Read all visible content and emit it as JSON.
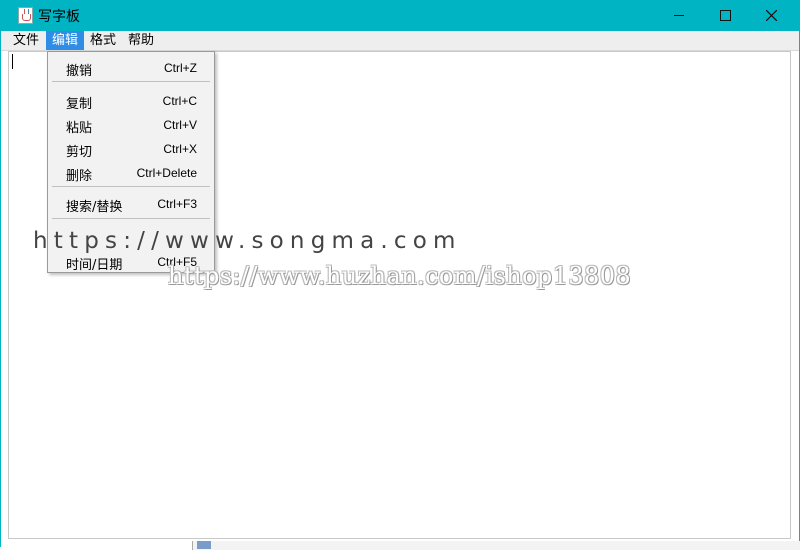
{
  "window": {
    "title": "写字板",
    "controls": [
      "minimize-icon",
      "maximize-icon",
      "close-icon"
    ],
    "title_bar_color": "#00b4c4"
  },
  "menubar": {
    "items": [
      {
        "label": "文件",
        "active": false
      },
      {
        "label": "编辑",
        "active": true
      },
      {
        "label": "格式",
        "active": false
      },
      {
        "label": "帮助",
        "active": false
      }
    ],
    "active_color": "#2f8de6"
  },
  "edit_menu": {
    "items": [
      {
        "label": "撤销",
        "shortcut": "Ctrl+Z"
      },
      {
        "label": "复制",
        "shortcut": "Ctrl+C"
      },
      {
        "label": "粘贴",
        "shortcut": "Ctrl+V"
      },
      {
        "label": "剪切",
        "shortcut": "Ctrl+X"
      },
      {
        "label": "删除",
        "shortcut": "Ctrl+Delete"
      },
      {
        "label": "搜索/替换",
        "shortcut": "Ctrl+F3"
      },
      {
        "label": "时间/日期",
        "shortcut": "Ctrl+F5"
      }
    ]
  },
  "watermarks": {
    "primary": "https://www.songma.com",
    "secondary": "https://www.huzhan.com/ishop13808"
  }
}
